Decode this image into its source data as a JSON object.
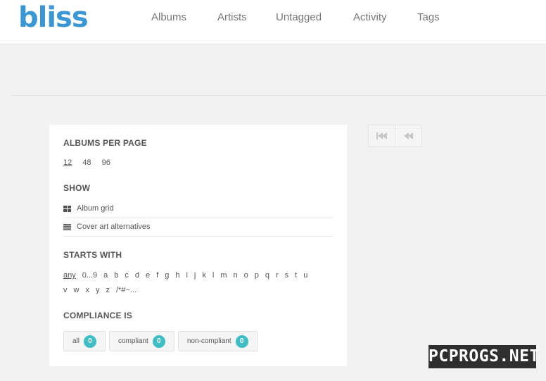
{
  "app": {
    "logo": "bliss"
  },
  "nav": {
    "items": [
      "Albums",
      "Artists",
      "Untagged",
      "Activity",
      "Tags"
    ]
  },
  "albums_per_page": {
    "title": "ALBUMS PER PAGE",
    "options": [
      "12",
      "48",
      "96"
    ],
    "selected": "12"
  },
  "show": {
    "title": "SHOW",
    "options": [
      {
        "label": "Album grid",
        "icon": "grid-icon"
      },
      {
        "label": "Cover art alternatives",
        "icon": "list-icon"
      }
    ]
  },
  "starts_with": {
    "title": "STARTS WITH",
    "row1": [
      "any",
      "0...9",
      "a",
      "b",
      "c",
      "d",
      "e",
      "f",
      "g",
      "h",
      "i",
      "j",
      "k",
      "l",
      "m",
      "n",
      "o",
      "p",
      "q",
      "r",
      "s",
      "t",
      "u"
    ],
    "row2": [
      "v",
      "w",
      "x",
      "y",
      "z",
      "/*#~..."
    ],
    "selected": "any"
  },
  "compliance": {
    "title": "COMPLIANCE IS",
    "options": [
      {
        "label": "all",
        "count": "0"
      },
      {
        "label": "compliant",
        "count": "0"
      },
      {
        "label": "non-compliant",
        "count": "0"
      }
    ]
  },
  "pager": {
    "buttons": [
      "first-page-icon",
      "previous-page-icon"
    ]
  },
  "watermark": "PCPROGS.NET",
  "colors": {
    "logo": "#3a97d3",
    "badge": "#3ebdc4",
    "background": "#f2f2f2"
  }
}
